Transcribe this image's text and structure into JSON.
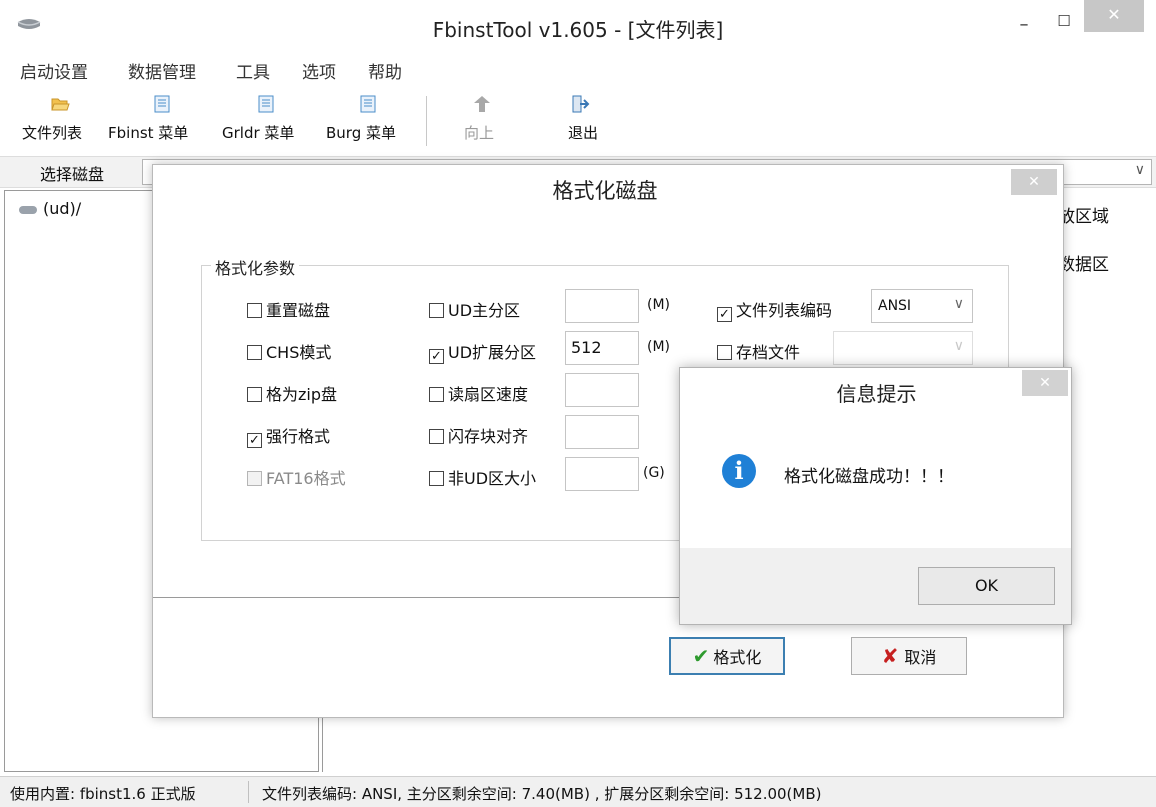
{
  "window": {
    "title": "FbinstTool v1.605 - [文件列表]",
    "minimize_glyph": "–",
    "maximize_glyph": "☐",
    "close_glyph": "✕"
  },
  "menu": [
    "启动设置",
    "数据管理",
    "工具",
    "选项",
    "帮助"
  ],
  "toolbar": [
    {
      "label": "文件列表",
      "icon": "folder-open-icon",
      "color": "#f2c14e"
    },
    {
      "label": "Fbinst 菜单",
      "icon": "document-icon",
      "color": "#4b8ec8"
    },
    {
      "label": "Grldr 菜单",
      "icon": "document-icon",
      "color": "#4b8ec8"
    },
    {
      "label": "Burg 菜单",
      "icon": "document-icon",
      "color": "#4b8ec8"
    },
    {
      "label": "向上",
      "icon": "arrow-up-icon",
      "color": "#a0a0a0"
    },
    {
      "label": "退出",
      "icon": "exit-icon",
      "color": "#3a78b5"
    }
  ],
  "disk": {
    "label": "选择磁盘",
    "arrow": "∨"
  },
  "tree": {
    "item": "(ud)/"
  },
  "right_pane": {
    "col1": "放区域",
    "col2": "数据区"
  },
  "status": {
    "left": "使用内置: fbinst1.6 正式版",
    "right": "文件列表编码: ANSI, 主分区剩余空间: 7.40(MB) , 扩展分区剩余空间: 512.00(MB)"
  },
  "format_dialog": {
    "title": "格式化磁盘",
    "close_glyph": "✕",
    "group_label": "格式化参数",
    "col1": [
      {
        "label": "重置磁盘",
        "checked": false,
        "disabled": false
      },
      {
        "label": "CHS模式",
        "checked": false,
        "disabled": false
      },
      {
        "label": "格为zip盘",
        "checked": false,
        "disabled": false
      },
      {
        "label": "强行格式",
        "checked": true,
        "disabled": false
      },
      {
        "label": "FAT16格式",
        "checked": false,
        "disabled": true
      }
    ],
    "col2": [
      {
        "label": "UD主分区",
        "checked": false,
        "value": "",
        "unit": "(M)"
      },
      {
        "label": "UD扩展分区",
        "checked": true,
        "value": "512",
        "unit": "(M)"
      },
      {
        "label": "读扇区速度",
        "checked": false,
        "value": "",
        "unit": ""
      },
      {
        "label": "闪存块对齐",
        "checked": false,
        "value": "",
        "unit": ""
      },
      {
        "label": "非UD区大小",
        "checked": false,
        "value": "",
        "unit": "(G)"
      }
    ],
    "col3": [
      {
        "label": "文件列表编码",
        "checked": true,
        "select": "ANSI",
        "disabled": false
      },
      {
        "label": "存档文件",
        "checked": false,
        "select": "",
        "disabled": true
      }
    ],
    "check_glyph": "✓",
    "format_button": "格式化",
    "format_glyph": "✔",
    "cancel_button": "取消",
    "cancel_glyph": "✘"
  },
  "info_dialog": {
    "title": "信息提示",
    "close_glyph": "✕",
    "icon_glyph": "i",
    "message": "格式化磁盘成功！！！",
    "ok_button": "OK"
  }
}
